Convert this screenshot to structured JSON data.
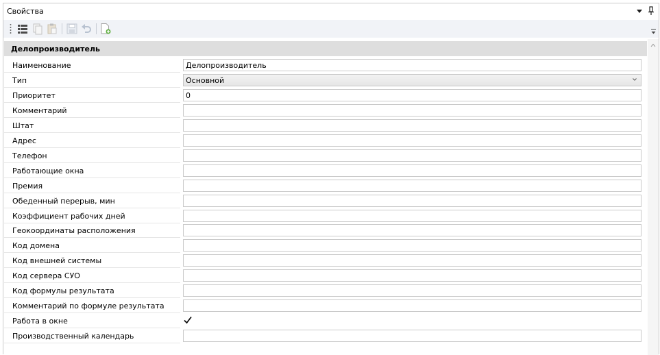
{
  "window": {
    "title": "Свойства"
  },
  "toolbar": {
    "buttons": [
      "categorized-view-icon",
      "copy-icon",
      "paste-icon",
      "save-icon",
      "undo-icon",
      "new-document-icon"
    ]
  },
  "section": {
    "title": "Делопроизводитель"
  },
  "properties": [
    {
      "label": "Наименование",
      "value": "Делопроизводитель",
      "type": "text"
    },
    {
      "label": "Тип",
      "value": "Основной",
      "type": "combo"
    },
    {
      "label": "Приоритет",
      "value": "0",
      "type": "text"
    },
    {
      "label": "Комментарий",
      "value": "",
      "type": "text"
    },
    {
      "label": "Штат",
      "value": "",
      "type": "text"
    },
    {
      "label": "Адрес",
      "value": "",
      "type": "text"
    },
    {
      "label": "Телефон",
      "value": "",
      "type": "text"
    },
    {
      "label": "Работающие окна",
      "value": "",
      "type": "text"
    },
    {
      "label": "Премия",
      "value": "",
      "type": "text"
    },
    {
      "label": "Обеденный перерыв, мин",
      "value": "",
      "type": "text"
    },
    {
      "label": "Коэффициент рабочих дней",
      "value": "",
      "type": "text"
    },
    {
      "label": "Геокоординаты расположения",
      "value": "",
      "type": "text"
    },
    {
      "label": "Код домена",
      "value": "",
      "type": "text"
    },
    {
      "label": "Код внешней системы",
      "value": "",
      "type": "text"
    },
    {
      "label": "Код сервера СУО",
      "value": "",
      "type": "text"
    },
    {
      "label": "Код формулы результата",
      "value": "",
      "type": "text"
    },
    {
      "label": "Комментарий по формуле результата",
      "value": "",
      "type": "text"
    },
    {
      "label": "Работа в окне",
      "value": true,
      "type": "checkbox"
    },
    {
      "label": "Производственный календарь",
      "value": "",
      "type": "text"
    }
  ]
}
